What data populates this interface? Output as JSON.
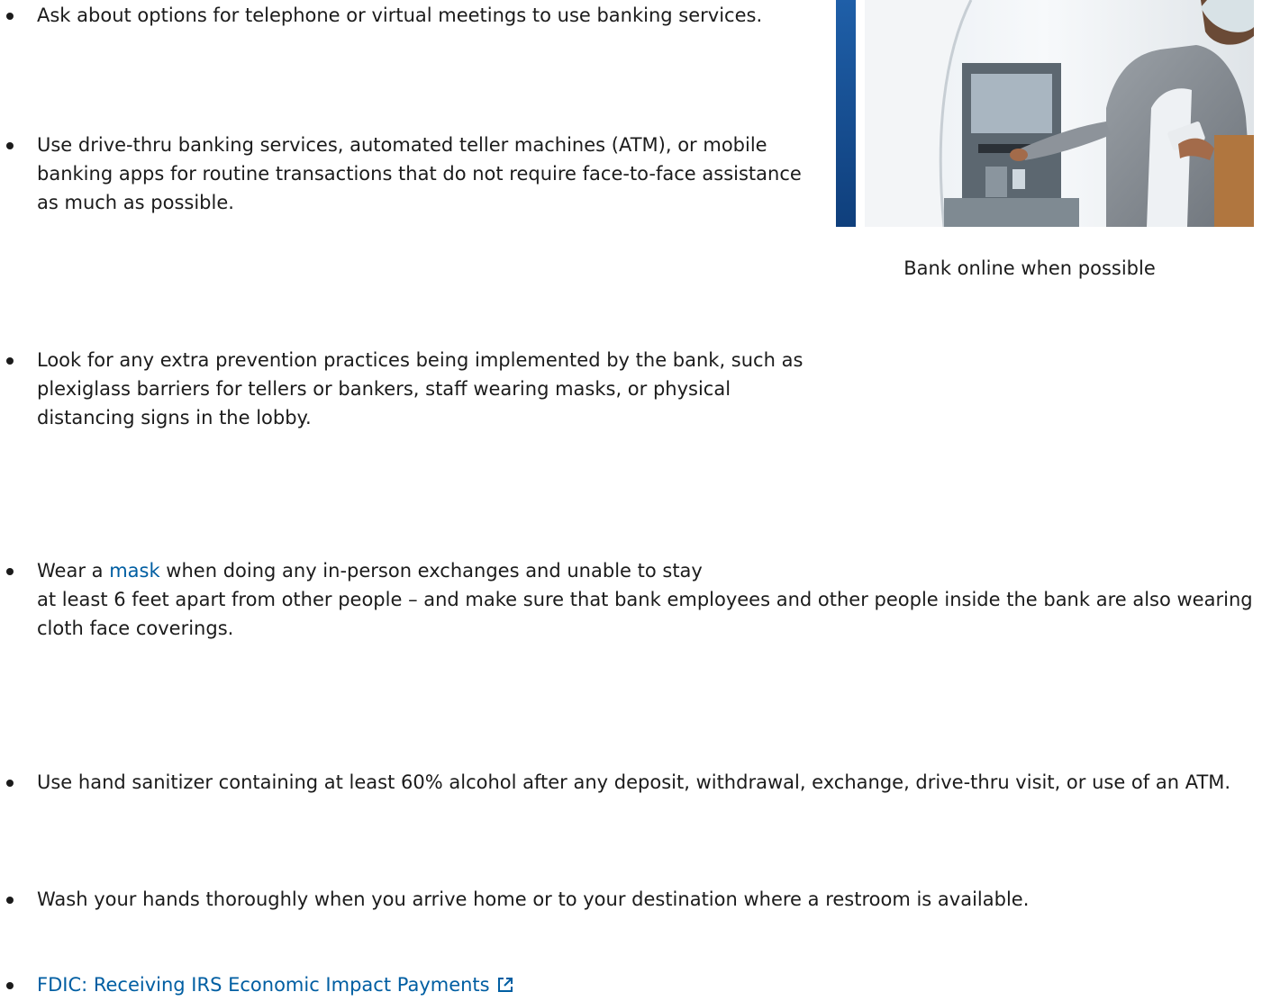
{
  "bullets": [
    {
      "text": "Ask about options for telephone or virtual meetings to use banking services."
    },
    {
      "text": "Use drive-thru banking services, automated teller machines (ATM), or mobile banking apps for routine transactions that do not require face-to-face assistance as much as possible."
    },
    {
      "text": "Look for any extra prevention practices being implemented by the bank, such as plexiglass barriers for tellers or bankers, staff wearing masks, or physical distancing signs in the lobby."
    },
    {
      "before": "Wear a ",
      "link": "mask",
      "after": " when doing any in-person exchanges and unable to stay",
      "continuation": "at least 6 feet apart from other people – and make sure that bank employees and other people inside the bank are also wearing cloth face coverings."
    },
    {
      "text": "Use hand sanitizer containing at least 60% alcohol after any deposit, withdrawal, exchange, drive-thru visit, or use of an ATM."
    },
    {
      "text": "Wash your hands thoroughly when you arrive home or to your destination where a restroom is available."
    },
    {
      "link": "FDIC: Receiving IRS Economic Impact Payments",
      "icon": "external-link-icon"
    }
  ],
  "figure": {
    "caption": "Bank online when possible"
  },
  "colors": {
    "text": "#1b1b1b",
    "link": "#005ea2"
  }
}
